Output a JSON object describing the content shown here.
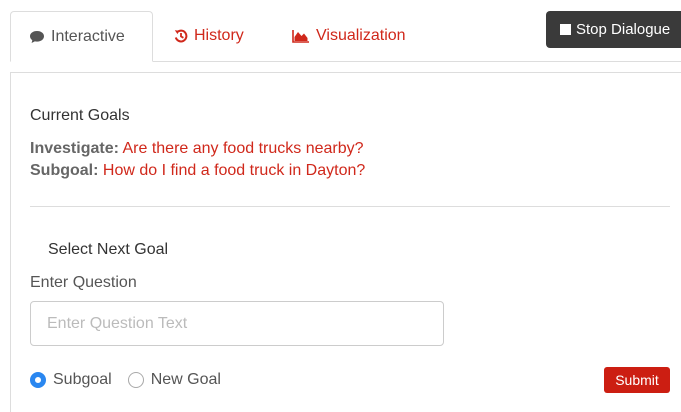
{
  "tabs": {
    "interactive": {
      "label": "Interactive",
      "icon": "comment-icon"
    },
    "history": {
      "label": "History",
      "icon": "history-icon"
    },
    "visualization": {
      "label": "Visualization",
      "icon": "area-chart-icon"
    }
  },
  "stop_button": {
    "label": "Stop Dialogue",
    "icon": "stop-square-icon"
  },
  "current_goals": {
    "title": "Current Goals",
    "investigate_label": "Investigate:",
    "investigate_value": "Are there any food trucks nearby?",
    "subgoal_label": "Subgoal:",
    "subgoal_value": "How do I find a food truck in Dayton?"
  },
  "next_goal": {
    "title": "Select Next Goal",
    "question_label": "Enter Question",
    "question_placeholder": "Enter Question Text",
    "question_value": ""
  },
  "goal_type": {
    "options": [
      {
        "label": "Subgoal",
        "checked": true
      },
      {
        "label": "New Goal",
        "checked": false
      }
    ]
  },
  "submit": {
    "label": "Submit"
  },
  "colors": {
    "accent_red": "#d0281b",
    "submit_red": "#cc1e12",
    "radio_blue": "#2a87f0",
    "dark_button": "#3a3a3a"
  }
}
